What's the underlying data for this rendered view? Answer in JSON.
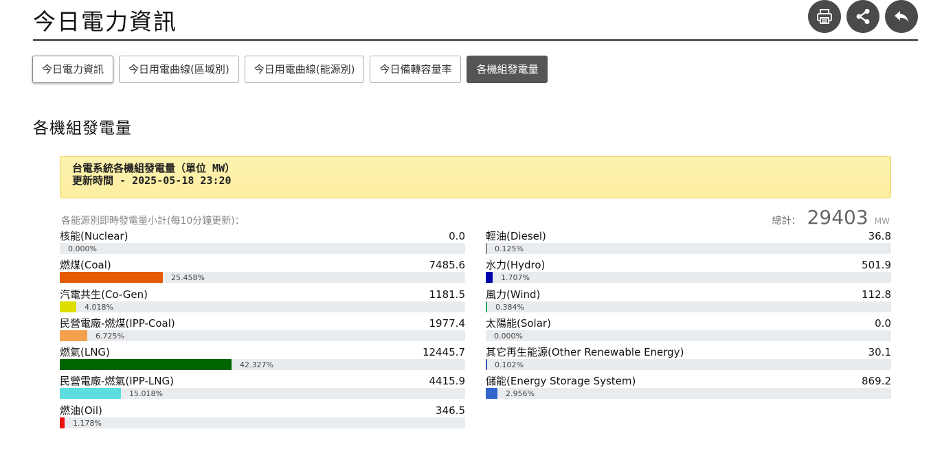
{
  "header": {
    "title": "今日電力資訊",
    "actions": [
      {
        "name": "print-button",
        "icon": "printer-icon"
      },
      {
        "name": "share-button",
        "icon": "share-icon"
      },
      {
        "name": "back-button",
        "icon": "back-arrow-icon"
      }
    ]
  },
  "tabs": [
    {
      "label": "今日電力資訊",
      "active": false
    },
    {
      "label": "今日用電曲線(區域別)",
      "active": false
    },
    {
      "label": "今日用電曲線(能源別)",
      "active": false
    },
    {
      "label": "今日備轉容量率",
      "active": false
    },
    {
      "label": "各機組發電量",
      "active": true
    }
  ],
  "section_title": "各機組發電量",
  "info_box": {
    "line1": "台電系統各機組發電量（單位 MW）",
    "line2": "更新時間 - 2025-05-18 23:20"
  },
  "summary": {
    "subtitle": "各能源別即時發電量小計(每10分鐘更新)：",
    "total_label": "總計：",
    "total_value": "29403",
    "total_unit": "MW"
  },
  "sources_left": [
    {
      "name": "核能(Nuclear)",
      "value": "0.0",
      "percent": "0.000%",
      "fraction": 0.0,
      "color": "#e9ecef"
    },
    {
      "name": "燃煤(Coal)",
      "value": "7485.6",
      "percent": "25.458%",
      "fraction": 0.25458,
      "color": "#e55b00"
    },
    {
      "name": "汽電共生(Co-Gen)",
      "value": "1181.5",
      "percent": "4.018%",
      "fraction": 0.04018,
      "color": "#dede00"
    },
    {
      "name": "民營電廠-燃煤(IPP-Coal)",
      "value": "1977.4",
      "percent": "6.725%",
      "fraction": 0.06725,
      "color": "#f5a04c"
    },
    {
      "name": "燃氣(LNG)",
      "value": "12445.7",
      "percent": "42.327%",
      "fraction": 0.42327,
      "color": "#006400"
    },
    {
      "name": "民營電廠-燃氣(IPP-LNG)",
      "value": "4415.9",
      "percent": "15.018%",
      "fraction": 0.15018,
      "color": "#5ddede"
    },
    {
      "name": "燃油(Oil)",
      "value": "346.5",
      "percent": "1.178%",
      "fraction": 0.01178,
      "color": "#ee1111"
    }
  ],
  "sources_right": [
    {
      "name": "輕油(Diesel)",
      "value": "36.8",
      "percent": "0.125%",
      "fraction": 0.00125,
      "color": "#888888"
    },
    {
      "name": "水力(Hydro)",
      "value": "501.9",
      "percent": "1.707%",
      "fraction": 0.01707,
      "color": "#0000aa"
    },
    {
      "name": "風力(Wind)",
      "value": "112.8",
      "percent": "0.384%",
      "fraction": 0.00384,
      "color": "#22aa55"
    },
    {
      "name": "太陽能(Solar)",
      "value": "0.0",
      "percent": "0.000%",
      "fraction": 0.0,
      "color": "#e9ecef"
    },
    {
      "name": "其它再生能源(Other Renewable Energy)",
      "value": "30.1",
      "percent": "0.102%",
      "fraction": 0.00102,
      "color": "#3355aa"
    },
    {
      "name": "儲能(Energy Storage System)",
      "value": "869.2",
      "percent": "2.956%",
      "fraction": 0.02956,
      "color": "#3366cc"
    }
  ]
}
